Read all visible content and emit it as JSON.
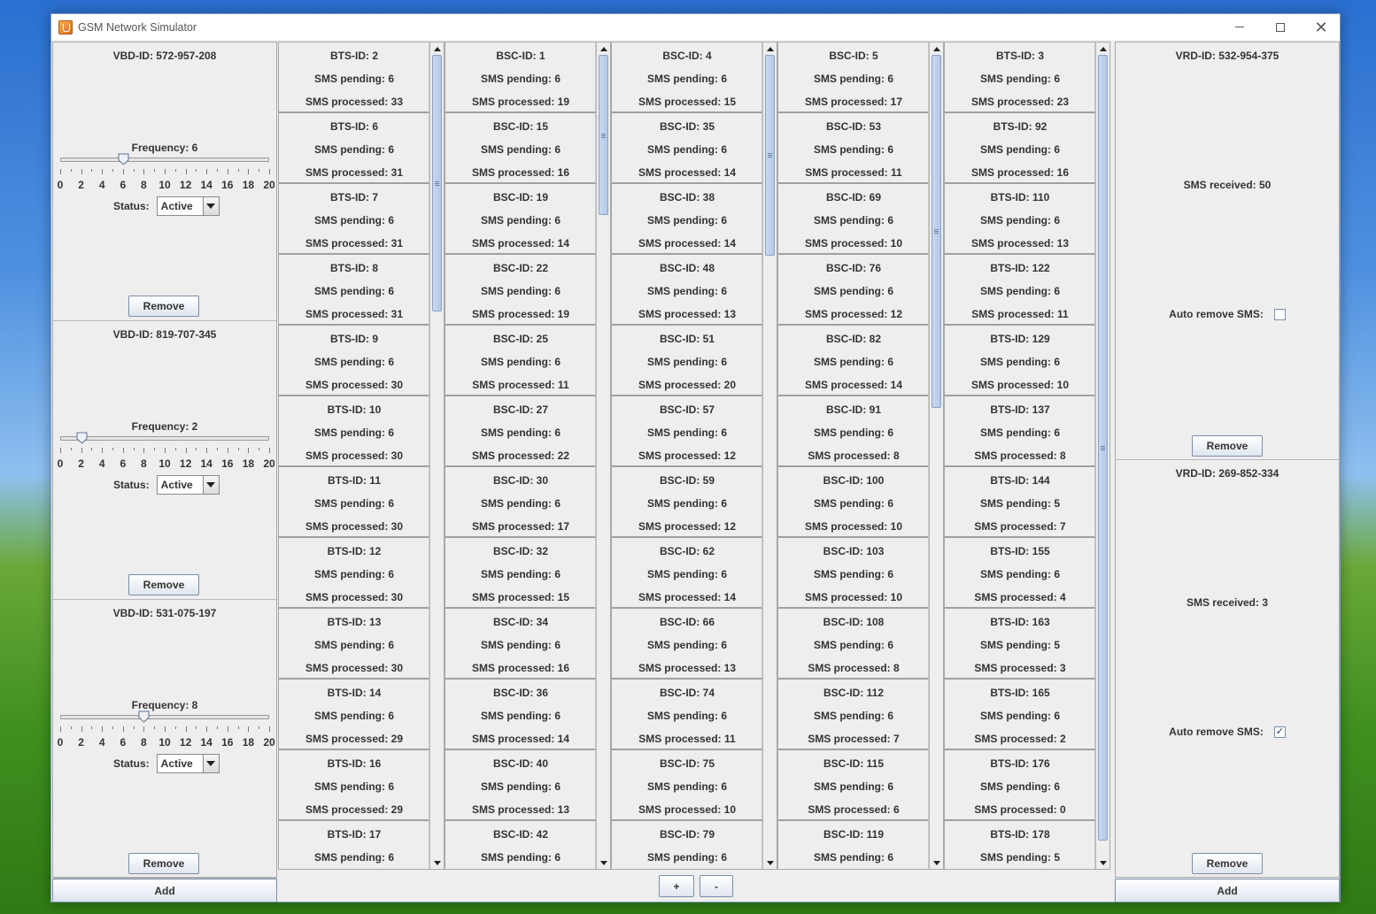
{
  "window": {
    "title": "GSM Network Simulator"
  },
  "vbd_panels": [
    {
      "id_label": "VBD-ID: 572-957-208",
      "frequency_label": "Frequency: 6",
      "frequency": 6,
      "status_label": "Status:",
      "status_value": "Active",
      "remove_label": "Remove"
    },
    {
      "id_label": "VBD-ID: 819-707-345",
      "frequency_label": "Frequency: 2",
      "frequency": 2,
      "status_label": "Status:",
      "status_value": "Active",
      "remove_label": "Remove"
    },
    {
      "id_label": "VBD-ID: 531-075-197",
      "frequency_label": "Frequency: 8",
      "frequency": 8,
      "status_label": "Status:",
      "status_value": "Active",
      "remove_label": "Remove"
    }
  ],
  "slider_ticks": [
    "0",
    "2",
    "4",
    "6",
    "8",
    "10",
    "12",
    "14",
    "16",
    "18",
    "20"
  ],
  "slider_max": 20,
  "left_add_label": "Add",
  "right_add_label": "Add",
  "plus_label": "+",
  "minus_label": "-",
  "columns": [
    {
      "scroll": {
        "thumb_start": 0.0,
        "thumb_size": 0.32
      },
      "cards": [
        [
          "BTS-ID: 2",
          "SMS pending: 6",
          "SMS processed: 33"
        ],
        [
          "BTS-ID: 6",
          "SMS pending: 6",
          "SMS processed: 31"
        ],
        [
          "BTS-ID: 7",
          "SMS pending: 6",
          "SMS processed: 31"
        ],
        [
          "BTS-ID: 8",
          "SMS pending: 6",
          "SMS processed: 31"
        ],
        [
          "BTS-ID: 9",
          "SMS pending: 6",
          "SMS processed: 30"
        ],
        [
          "BTS-ID: 10",
          "SMS pending: 6",
          "SMS processed: 30"
        ],
        [
          "BTS-ID: 11",
          "SMS pending: 6",
          "SMS processed: 30"
        ],
        [
          "BTS-ID: 12",
          "SMS pending: 6",
          "SMS processed: 30"
        ],
        [
          "BTS-ID: 13",
          "SMS pending: 6",
          "SMS processed: 30"
        ],
        [
          "BTS-ID: 14",
          "SMS pending: 6",
          "SMS processed: 29"
        ],
        [
          "BTS-ID: 16",
          "SMS pending: 6",
          "SMS processed: 29"
        ],
        [
          "BTS-ID: 17",
          "SMS pending: 6"
        ]
      ]
    },
    {
      "scroll": {
        "thumb_start": 0.0,
        "thumb_size": 0.2
      },
      "cards": [
        [
          "BSC-ID: 1",
          "SMS pending: 6",
          "SMS processed: 19"
        ],
        [
          "BSC-ID: 15",
          "SMS pending: 6",
          "SMS processed: 16"
        ],
        [
          "BSC-ID: 19",
          "SMS pending: 6",
          "SMS processed: 14"
        ],
        [
          "BSC-ID: 22",
          "SMS pending: 6",
          "SMS processed: 19"
        ],
        [
          "BSC-ID: 25",
          "SMS pending: 6",
          "SMS processed: 11"
        ],
        [
          "BSC-ID: 27",
          "SMS pending: 6",
          "SMS processed: 22"
        ],
        [
          "BSC-ID: 30",
          "SMS pending: 6",
          "SMS processed: 17"
        ],
        [
          "BSC-ID: 32",
          "SMS pending: 6",
          "SMS processed: 15"
        ],
        [
          "BSC-ID: 34",
          "SMS pending: 6",
          "SMS processed: 16"
        ],
        [
          "BSC-ID: 36",
          "SMS pending: 6",
          "SMS processed: 14"
        ],
        [
          "BSC-ID: 40",
          "SMS pending: 6",
          "SMS processed: 13"
        ],
        [
          "BSC-ID: 42",
          "SMS pending: 6"
        ]
      ]
    },
    {
      "scroll": {
        "thumb_start": 0.0,
        "thumb_size": 0.25
      },
      "cards": [
        [
          "BSC-ID: 4",
          "SMS pending: 6",
          "SMS processed: 15"
        ],
        [
          "BSC-ID: 35",
          "SMS pending: 6",
          "SMS processed: 14"
        ],
        [
          "BSC-ID: 38",
          "SMS pending: 6",
          "SMS processed: 14"
        ],
        [
          "BSC-ID: 48",
          "SMS pending: 6",
          "SMS processed: 13"
        ],
        [
          "BSC-ID: 51",
          "SMS pending: 6",
          "SMS processed: 20"
        ],
        [
          "BSC-ID: 57",
          "SMS pending: 6",
          "SMS processed: 12"
        ],
        [
          "BSC-ID: 59",
          "SMS pending: 6",
          "SMS processed: 12"
        ],
        [
          "BSC-ID: 62",
          "SMS pending: 6",
          "SMS processed: 14"
        ],
        [
          "BSC-ID: 66",
          "SMS pending: 6",
          "SMS processed: 13"
        ],
        [
          "BSC-ID: 74",
          "SMS pending: 6",
          "SMS processed: 11"
        ],
        [
          "BSC-ID: 75",
          "SMS pending: 6",
          "SMS processed: 10"
        ],
        [
          "BSC-ID: 79",
          "SMS pending: 6"
        ]
      ]
    },
    {
      "scroll": {
        "thumb_start": 0.0,
        "thumb_size": 0.44
      },
      "cards": [
        [
          "BSC-ID: 5",
          "SMS pending: 6",
          "SMS processed: 17"
        ],
        [
          "BSC-ID: 53",
          "SMS pending: 6",
          "SMS processed: 11"
        ],
        [
          "BSC-ID: 69",
          "SMS pending: 6",
          "SMS processed: 10"
        ],
        [
          "BSC-ID: 76",
          "SMS pending: 6",
          "SMS processed: 12"
        ],
        [
          "BSC-ID: 82",
          "SMS pending: 6",
          "SMS processed: 14"
        ],
        [
          "BSC-ID: 91",
          "SMS pending: 6",
          "SMS processed: 8"
        ],
        [
          "BSC-ID: 100",
          "SMS pending: 6",
          "SMS processed: 10"
        ],
        [
          "BSC-ID: 103",
          "SMS pending: 6",
          "SMS processed: 10"
        ],
        [
          "BSC-ID: 108",
          "SMS pending: 6",
          "SMS processed: 8"
        ],
        [
          "BSC-ID: 112",
          "SMS pending: 6",
          "SMS processed: 7"
        ],
        [
          "BSC-ID: 115",
          "SMS pending: 6",
          "SMS processed: 6"
        ],
        [
          "BSC-ID: 119",
          "SMS pending: 6"
        ]
      ]
    },
    {
      "scroll": {
        "thumb_start": 0.0,
        "thumb_size": 0.98
      },
      "cards": [
        [
          "BTS-ID: 3",
          "SMS pending: 6",
          "SMS processed: 23"
        ],
        [
          "BTS-ID: 92",
          "SMS pending: 6",
          "SMS processed: 16"
        ],
        [
          "BTS-ID: 110",
          "SMS pending: 6",
          "SMS processed: 13"
        ],
        [
          "BTS-ID: 122",
          "SMS pending: 6",
          "SMS processed: 11"
        ],
        [
          "BTS-ID: 129",
          "SMS pending: 6",
          "SMS processed: 10"
        ],
        [
          "BTS-ID: 137",
          "SMS pending: 6",
          "SMS processed: 8"
        ],
        [
          "BTS-ID: 144",
          "SMS pending: 5",
          "SMS processed: 7"
        ],
        [
          "BTS-ID: 155",
          "SMS pending: 6",
          "SMS processed: 4"
        ],
        [
          "BTS-ID: 163",
          "SMS pending: 5",
          "SMS processed: 3"
        ],
        [
          "BTS-ID: 165",
          "SMS pending: 6",
          "SMS processed: 2"
        ],
        [
          "BTS-ID: 176",
          "SMS pending: 6",
          "SMS processed: 0"
        ],
        [
          "BTS-ID: 178",
          "SMS pending: 5"
        ]
      ]
    }
  ],
  "vrd_panels": [
    {
      "id_label": "VRD-ID: 532-954-375",
      "received_label": "SMS received: 50",
      "auto_label": "Auto remove SMS:",
      "auto_checked": false,
      "remove_label": "Remove"
    },
    {
      "id_label": "VRD-ID: 269-852-334",
      "received_label": "SMS received: 3",
      "auto_label": "Auto remove SMS:",
      "auto_checked": true,
      "remove_label": "Remove"
    }
  ],
  "colors": {
    "accent": "#7a8ea8",
    "panel": "#eeeeee"
  }
}
